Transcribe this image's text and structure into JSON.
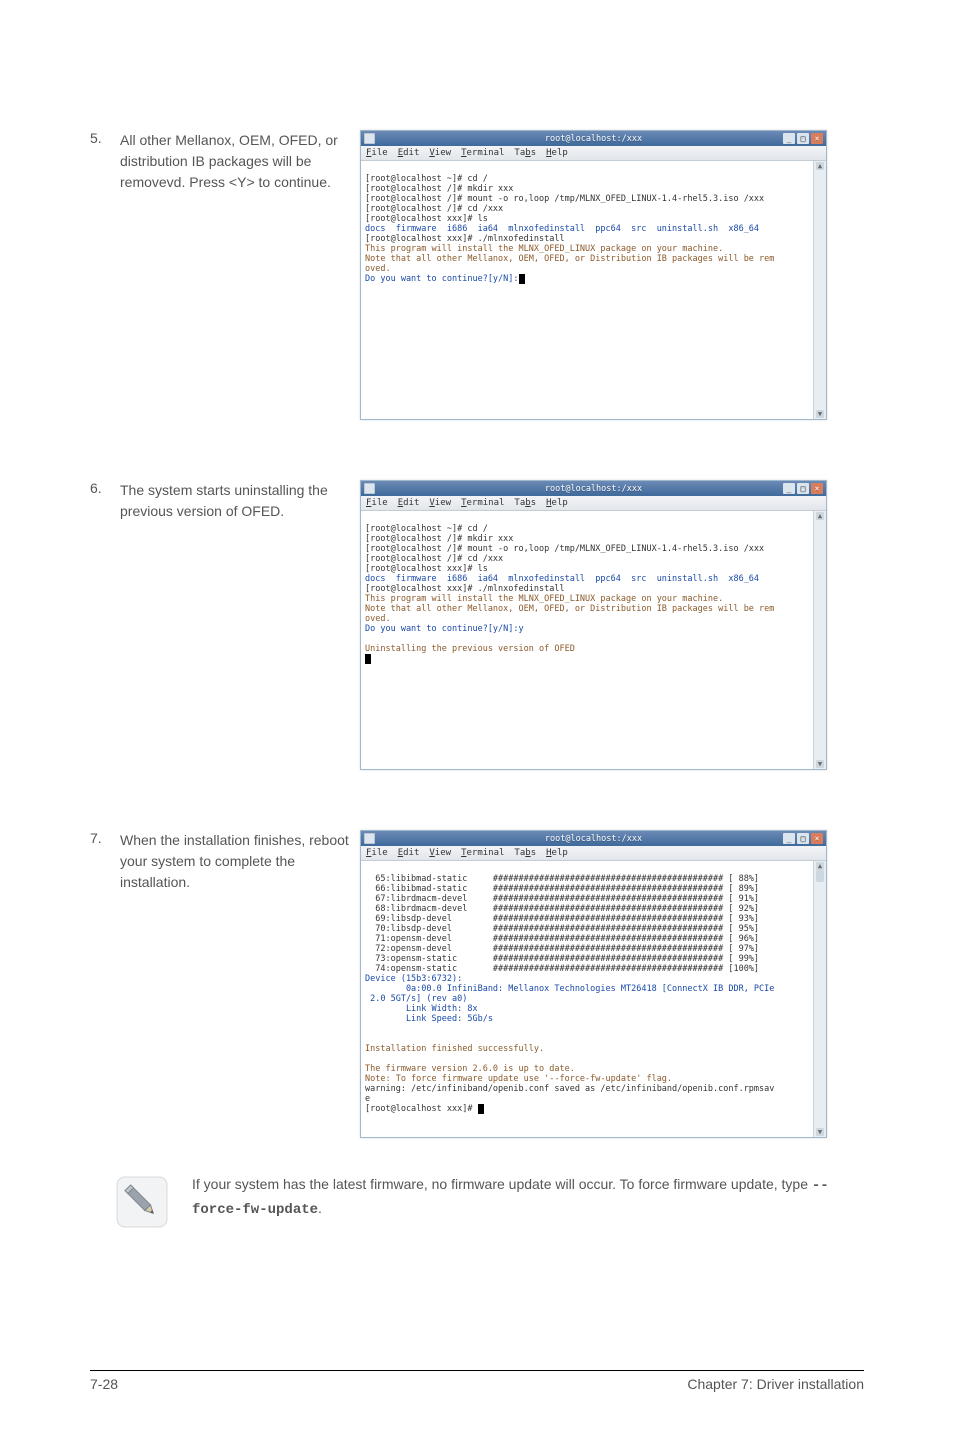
{
  "steps": [
    {
      "num": "5.",
      "text": "All other Mellanox, OEM, OFED, or distribution IB packages will be removevd. Press <Y> to continue."
    },
    {
      "num": "6.",
      "text": "The system starts uninstalling the previous version of OFED."
    },
    {
      "num": "7.",
      "text": "When the installation finishes, reboot your system to complete the installation."
    }
  ],
  "term_title": "root@localhost:/xxx",
  "menu": {
    "file": "File",
    "edit": "Edit",
    "view": "View",
    "terminal": "Terminal",
    "tabs": "Tabs",
    "help": "Help"
  },
  "win_btn": {
    "min": "_",
    "max": "□",
    "close": "×"
  },
  "scroll": {
    "up": "▲",
    "down": "▼"
  },
  "term1": {
    "l1": "[root@localhost ~]# cd /",
    "l2": "[root@localhost /]# mkdir xxx",
    "l3": "[root@localhost /]# mount -o ro,loop /tmp/MLNX_OFED_LINUX-1.4-rhel5.3.iso /xxx",
    "l4": "[root@localhost /]# cd /xxx",
    "l5": "[root@localhost xxx]# ls",
    "l6": "docs  firmware  i686  ia64  mlnxofedinstall  ppc64  src  uninstall.sh  x86_64",
    "l7": "[root@localhost xxx]# ./mlnxofedinstall",
    "l8": "This program will install the MLNX_OFED_LINUX package on your machine.",
    "l9": "Note that all other Mellanox, OEM, OFED, or Distribution IB packages will be rem",
    "l10": "oved.",
    "l11": "Do you want to continue?[y/N]:"
  },
  "term2": {
    "l1": "[root@localhost ~]# cd /",
    "l2": "[root@localhost /]# mkdir xxx",
    "l3": "[root@localhost /]# mount -o ro,loop /tmp/MLNX_OFED_LINUX-1.4-rhel5.3.iso /xxx",
    "l4": "[root@localhost /]# cd /xxx",
    "l5": "[root@localhost xxx]# ls",
    "l6": "docs  firmware  i686  ia64  mlnxofedinstall  ppc64  src  uninstall.sh  x86_64",
    "l7": "[root@localhost xxx]# ./mlnxofedinstall",
    "l8": "This program will install the MLNX_OFED_LINUX package on your machine.",
    "l9": "Note that all other Mellanox, OEM, OFED, or Distribution IB packages will be rem",
    "l10": "oved.",
    "l11": "Do you want to continue?[y/N]:y",
    "l12": "Uninstalling the previous version of OFED"
  },
  "term3": {
    "r1": "  65:libibmad-static     ############################################# [ 88%]",
    "r2": "  66:libibmad-static     ############################################# [ 89%]",
    "r3": "  67:librdmacm-devel     ############################################# [ 91%]",
    "r4": "  68:librdmacm-devel     ############################################# [ 92%]",
    "r5": "  69:libsdp-devel        ############################################# [ 93%]",
    "r6": "  70:libsdp-devel        ############################################# [ 95%]",
    "r7": "  71:opensm-devel        ############################################# [ 96%]",
    "r8": "  72:opensm-devel        ############################################# [ 97%]",
    "r9": "  73:opensm-static       ############################################# [ 99%]",
    "r10": "  74:opensm-static       ############################################# [100%]",
    "d1": "Device (15b3:6732):",
    "d2": "        0a:00.0 InfiniBand: Mellanox Technologies MT26418 [ConnectX IB DDR, PCIe",
    "d3": " 2.0 5GT/s] (rev a0)",
    "d4": "        Link Width: 8x",
    "d5": "        Link Speed: 5Gb/s",
    "s1": "Installation finished successfully.",
    "f1": "The firmware version 2.6.0 is up to date.",
    "f2": "Note: To force firmware update use '--force-fw-update' flag.",
    "w1": "warning: /etc/infiniband/openib.conf saved as /etc/infiniband/openib.conf.rpmsav",
    "w2": "e",
    "p": "[root@localhost xxx]# "
  },
  "note_text_a": "If your system has the latest firmware, no firmware update will occur. To force firmware update, type ",
  "note_code": "--force-fw-update",
  "note_text_b": ".",
  "footer": {
    "left": "7-28",
    "right": "Chapter 7: Driver installation"
  }
}
